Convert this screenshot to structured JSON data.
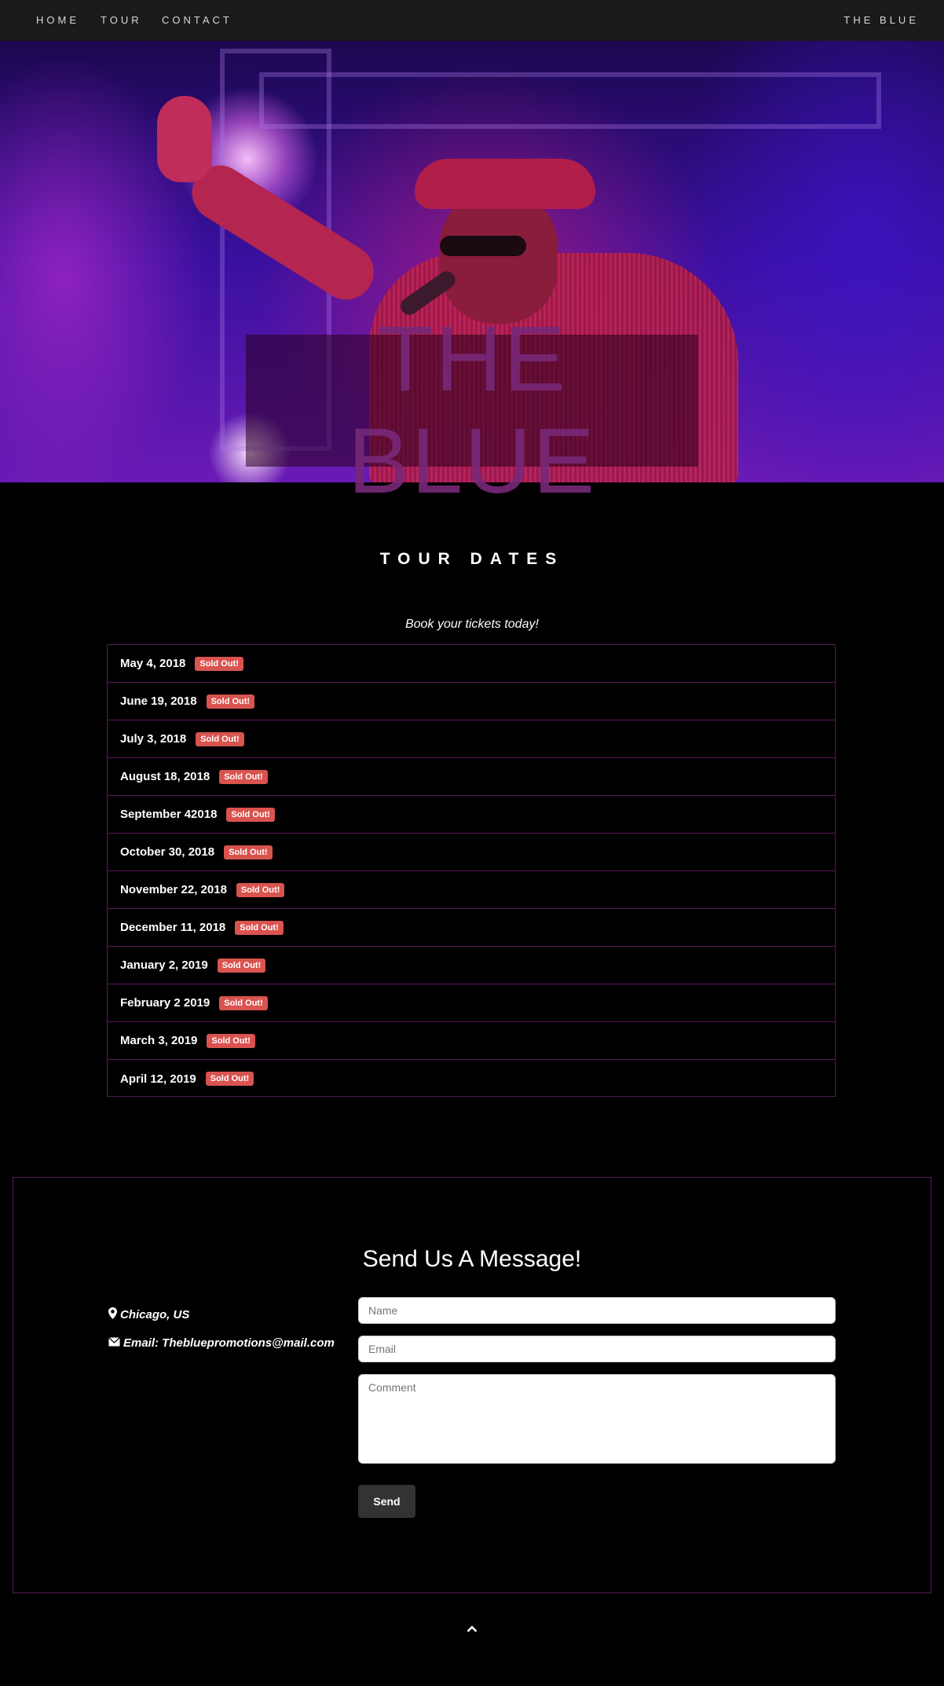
{
  "nav": {
    "home": "HOME",
    "tour": "TOUR",
    "contact": "CONTACT",
    "brand": "THE BLUE"
  },
  "hero": {
    "title": "THE BLUE"
  },
  "tour": {
    "title": "TOUR DATES",
    "subtitle": "Book your tickets today!",
    "badge": "Sold Out!",
    "dates": [
      "May 4, 2018",
      "June 19, 2018",
      "July 3, 2018",
      "August 18, 2018",
      "September 42018",
      "October 30, 2018",
      "November 22, 2018",
      "December 11, 2018",
      "January 2, 2019",
      "February 2 2019",
      "March 3, 2019",
      "April 12, 2019"
    ]
  },
  "contact": {
    "title": "Send Us A Message!",
    "location": "Chicago, US",
    "email": "Email: Thebluepromotions@mail.com",
    "name_placeholder": "Name",
    "email_placeholder": "Email",
    "comment_placeholder": "Comment",
    "send_label": "Send"
  },
  "icons": {
    "location": "map-marker-icon",
    "email": "envelope-icon",
    "scroll_up": "chevron-up-icon"
  },
  "colors": {
    "badge": "#d9534f",
    "border": "#5a1a5a",
    "navbar": "#1a1a1a"
  }
}
